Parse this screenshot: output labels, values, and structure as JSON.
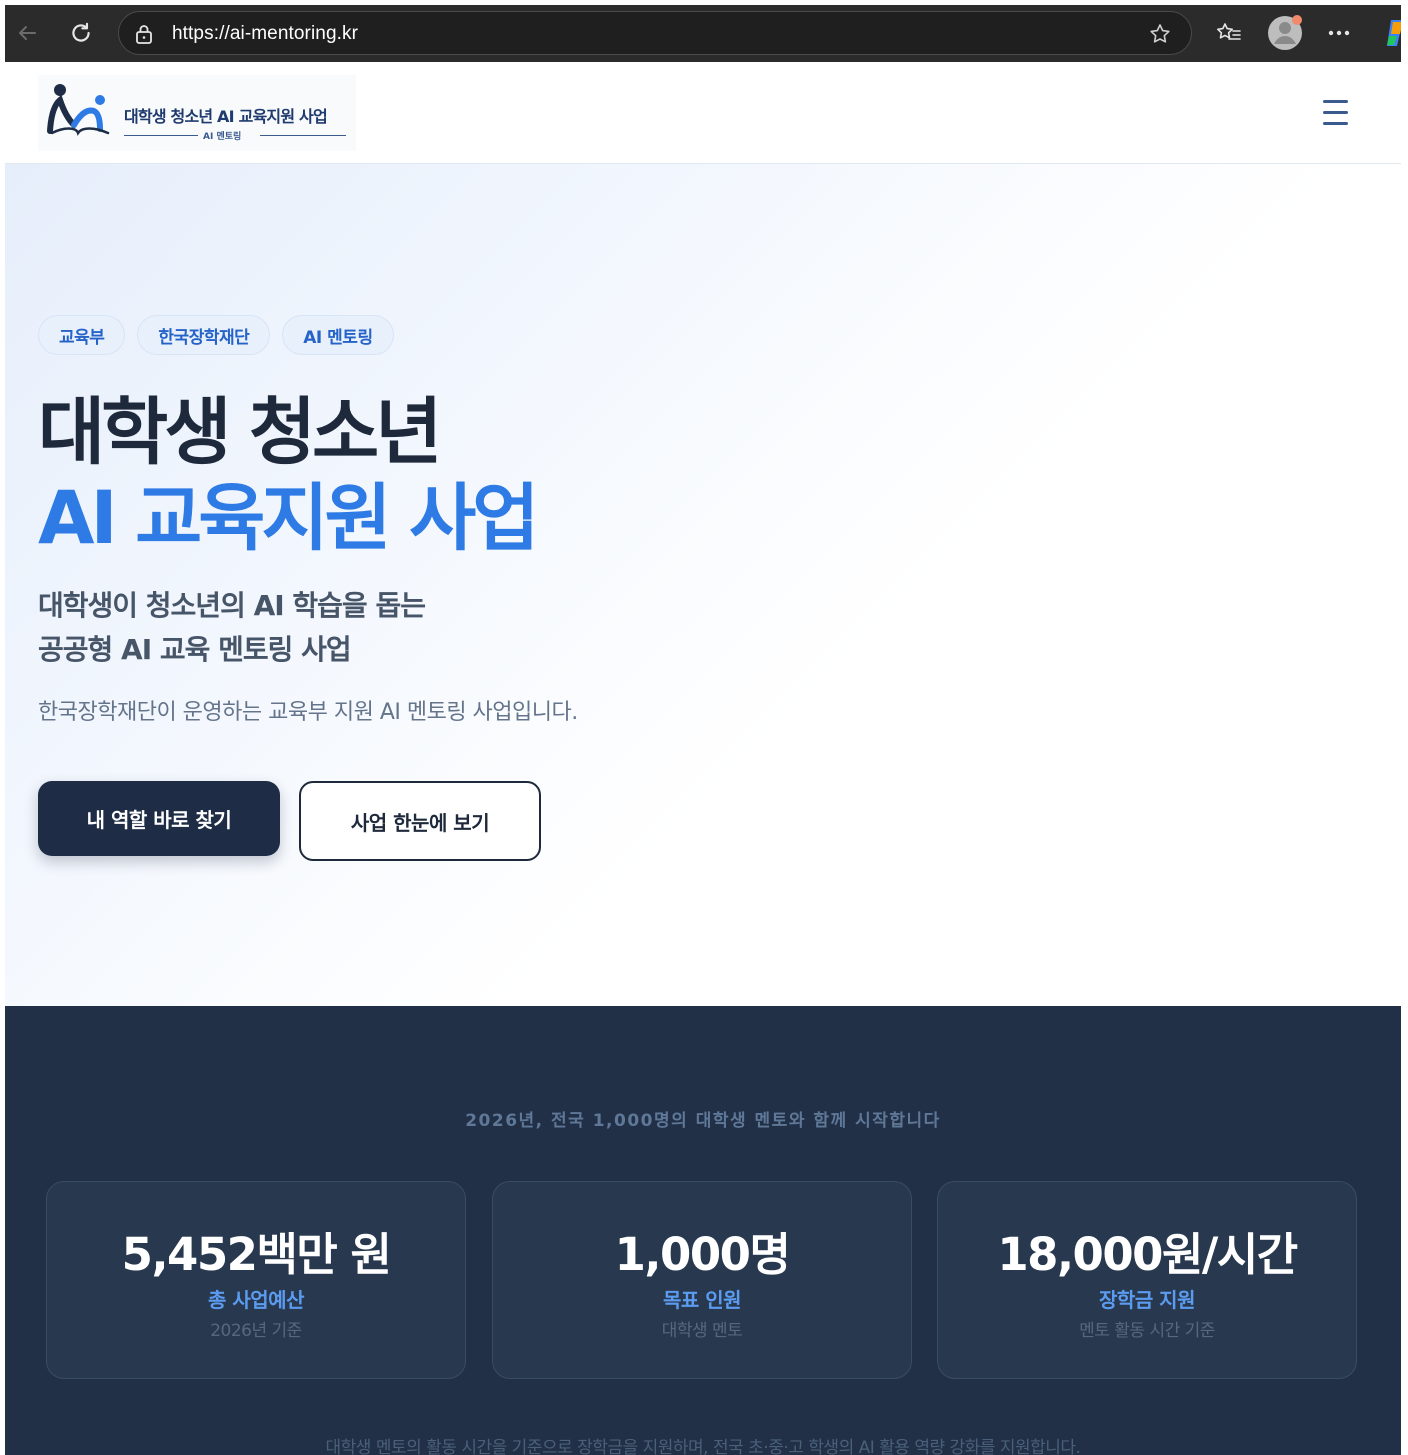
{
  "browser": {
    "url": "https://ai-mentoring.kr",
    "icons": [
      "back-arrow-icon",
      "refresh-icon",
      "lock-icon",
      "star-icon",
      "favorites-icon",
      "profile-avatar",
      "more-icon",
      "copilot-icon"
    ]
  },
  "header": {
    "logo_title": "대학생 청소년 AI 교육지원 사업",
    "logo_subtitle": "AI 멘토링",
    "menu_icon": "hamburger-menu-icon"
  },
  "hero": {
    "tags": [
      "교육부",
      "한국장학재단",
      "AI 멘토링"
    ],
    "title_line1": "대학생 청소년",
    "title_line2": "AI 교육지원 사업",
    "subtitle_line1": "대학생이 청소년의 AI 학습을 돕는",
    "subtitle_line2": "공공형 AI 교육 멘토링 사업",
    "description": "한국장학재단이 운영하는 교육부 지원 AI 멘토링 사업입니다.",
    "primary_button": "내 역할 바로 찾기",
    "secondary_button": "사업 한눈에 보기"
  },
  "stats": {
    "heading": "2026년, 전국 1,000명의 대학생 멘토와 함께 시작합니다",
    "cards": [
      {
        "value": "5,452백만 원",
        "label": "총 사업예산",
        "sub": "2026년 기준"
      },
      {
        "value": "1,000명",
        "label": "목표 인원",
        "sub": "대학생 멘토"
      },
      {
        "value": "18,000원/시간",
        "label": "장학금 지원",
        "sub": "멘토 활동 시간 기준"
      }
    ],
    "footer": "대학생 멘토의 활동 시간을 기준으로 장학금을 지원하며, 전국 초·중·고 학생의 AI 활용 역량 강화를 지원합니다."
  },
  "colors": {
    "accent_blue": "#2f7be5",
    "navy": "#1e2d45",
    "stats_bg": "#213046",
    "card_bg": "#28394f"
  }
}
